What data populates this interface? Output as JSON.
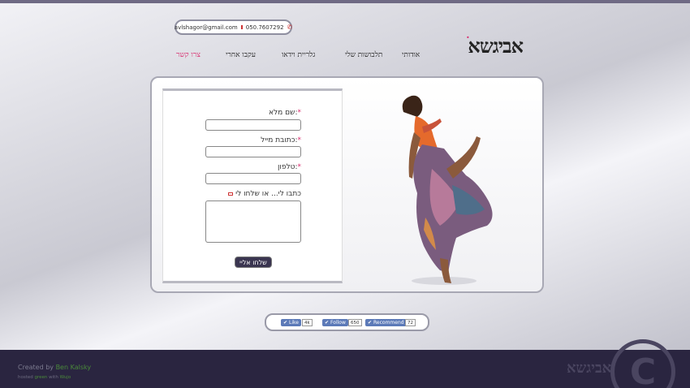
{
  "header": {
    "email": "avlshagor@gmail.com",
    "phone": "050.7607292",
    "logo_text": "אביגשא",
    "logo_accent": "ׄ"
  },
  "nav": {
    "items": [
      {
        "label": "אודותי",
        "active": false
      },
      {
        "label": "תלבושות שלי",
        "active": false
      },
      {
        "label": "גלריית וידאו",
        "active": false
      },
      {
        "label": "עקבו אחרי",
        "active": false
      },
      {
        "label": "צרו קשר",
        "active": true
      }
    ]
  },
  "form": {
    "name_label": "שם מלא:",
    "email_label": "כתובת מייל:",
    "phone_label": "טלפון:",
    "message_label": "כתבו לי... או שלחו לי",
    "required_mark": "*",
    "submit_label": "שלחו אליי"
  },
  "social": {
    "like_label": "Like",
    "like_count": "4k",
    "follow_label": "Follow",
    "follow_count": "650",
    "recommend_label": "Recommend",
    "recommend_count": "72"
  },
  "footer": {
    "created_prefix": "Created by",
    "created_name": "Ben Kalsky",
    "hosted_text_1": "hosted",
    "hosted_link_1": "green",
    "hosted_text_2": "with",
    "hosted_link_2": "Wujo",
    "logo_text": "אביגשא",
    "copyright_glyph": "C"
  },
  "colors": {
    "accent": "#d82a6c",
    "footer_bg": "#2a2540",
    "button": "#3a3550"
  }
}
